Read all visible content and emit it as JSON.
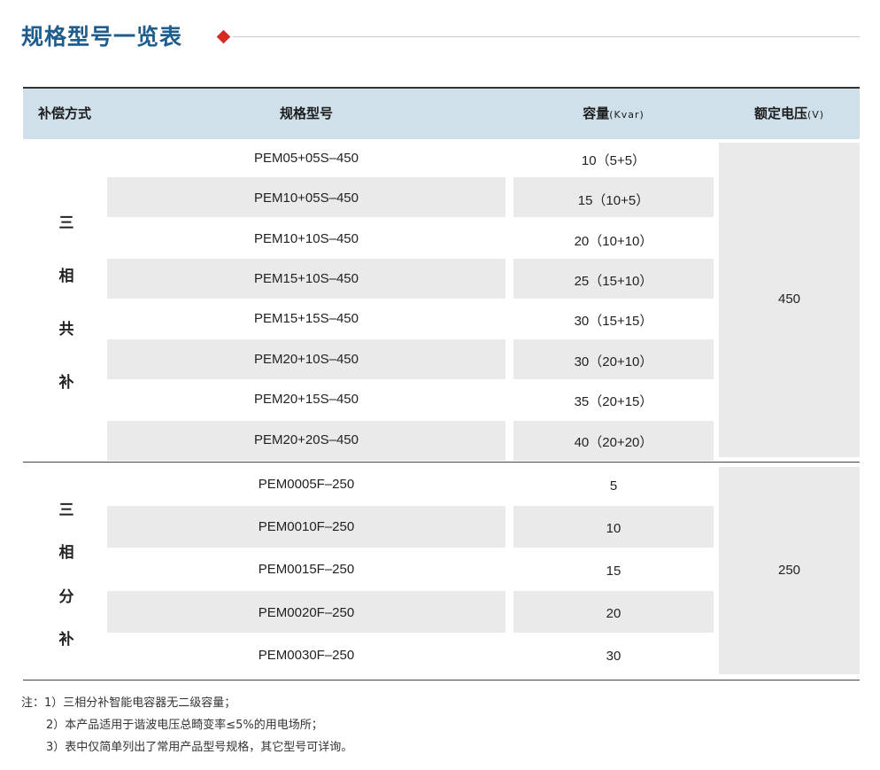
{
  "title": "规格型号一览表",
  "colors": {
    "title": "#1f5d8c",
    "accent": "#d42b22",
    "header_bg": "#cfe0ea",
    "band_bg": "#ebeaea"
  },
  "headers": {
    "method": "补偿方式",
    "model": "规格型号",
    "capacity": "容量",
    "capacity_unit": "(Kvar)",
    "voltage": "额定电压",
    "voltage_unit": "(V)"
  },
  "groups": [
    {
      "method_chars": [
        "三",
        "相",
        "共",
        "补"
      ],
      "voltage": "450",
      "rows": [
        {
          "model": "PEM05+05S–450",
          "capacity": "10（5+5）"
        },
        {
          "model": "PEM10+05S–450",
          "capacity": "15（10+5）"
        },
        {
          "model": "PEM10+10S–450",
          "capacity": "20（10+10）"
        },
        {
          "model": "PEM15+10S–450",
          "capacity": "25（15+10）"
        },
        {
          "model": "PEM15+15S–450",
          "capacity": "30（15+15）"
        },
        {
          "model": "PEM20+10S–450",
          "capacity": "30（20+10）"
        },
        {
          "model": "PEM20+15S–450",
          "capacity": "35（20+15）"
        },
        {
          "model": "PEM20+20S–450",
          "capacity": "40（20+20）"
        }
      ]
    },
    {
      "method_chars": [
        "三",
        "相",
        "分",
        "补"
      ],
      "voltage": "250",
      "rows": [
        {
          "model": "PEM0005F–250",
          "capacity": "5"
        },
        {
          "model": "PEM0010F–250",
          "capacity": "10"
        },
        {
          "model": "PEM0015F–250",
          "capacity": "15"
        },
        {
          "model": "PEM0020F–250",
          "capacity": "20"
        },
        {
          "model": "PEM0030F–250",
          "capacity": "30"
        }
      ]
    }
  ],
  "notes": [
    "注：1）三相分补智能电容器无二级容量；",
    "2）本产品适用于谐波电压总畸变率≤5%的用电场所；",
    "3）表中仅简单列出了常用产品型号规格，其它型号可详询。"
  ]
}
